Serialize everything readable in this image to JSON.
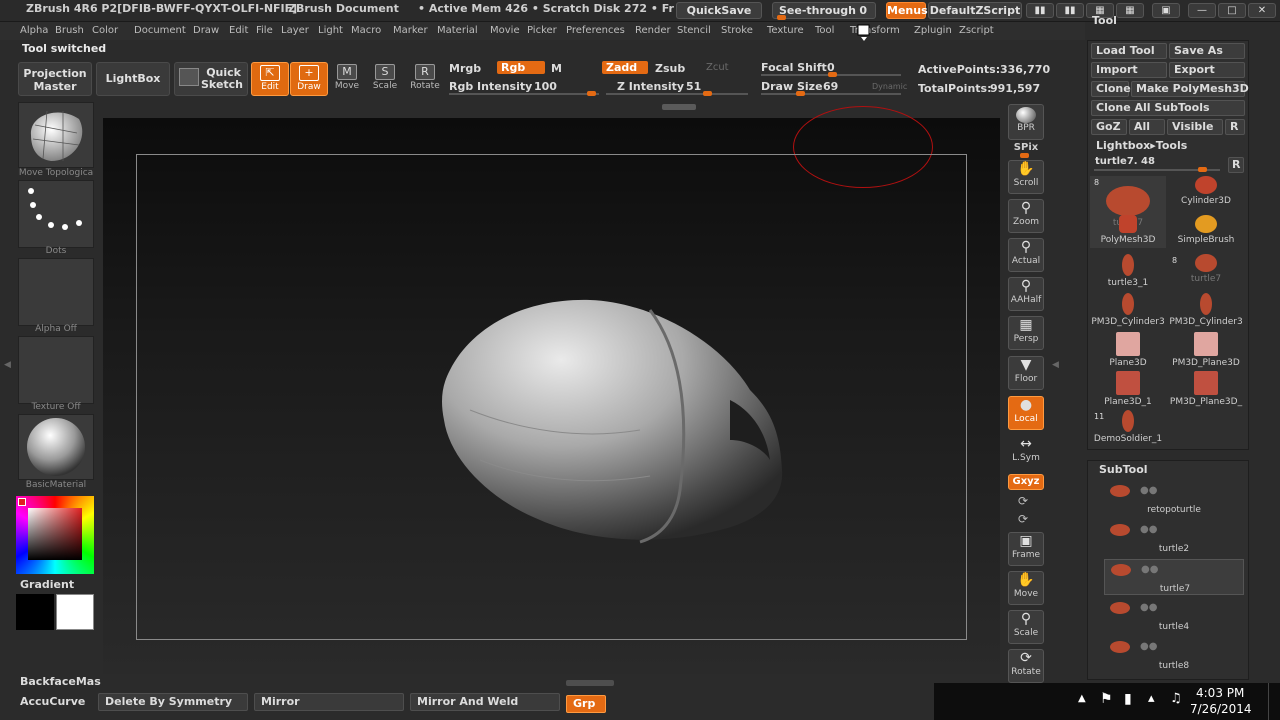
{
  "titlebar": {
    "app": "ZBrush 4R6  P2[DFIB-BWFF-QYXT-OLFI-NFIF]",
    "document": "ZBrush Document",
    "mem": "• Active Mem 426  • Scratch Disk 272  • Fr",
    "quicksave": "QuickSave",
    "seethrough": "See-through",
    "seethrough_value": "0",
    "menus": "Menus",
    "script": "DefaultZScript"
  },
  "menubar": [
    "Alpha",
    "Brush",
    "Color",
    "Document",
    "Draw",
    "Edit",
    "File",
    "Layer",
    "Light",
    "Macro",
    "Marker",
    "Material",
    "Movie",
    "Picker",
    "Preferences",
    "Render",
    "Stencil",
    "Stroke",
    "Texture",
    "Tool",
    "Transform",
    "Zplugin",
    "Zscript"
  ],
  "status": "Tool switched",
  "toolbar": {
    "projection_master": "Projection Master",
    "lightbox": "LightBox",
    "quick_sketch": "Quick Sketch",
    "edit": "Edit",
    "draw": "Draw",
    "move": "Move",
    "scale": "Scale",
    "rotate": "Rotate",
    "mrgb": "Mrgb",
    "rgb": "Rgb",
    "m": "M",
    "zadd": "Zadd",
    "zsub": "Zsub",
    "zcut": "Zcut",
    "rgb_intensity_label": "Rgb Intensity",
    "rgb_intensity": "100",
    "z_intensity_label": "Z Intensity",
    "z_intensity": "51",
    "focal_shift_label": "Focal Shift",
    "focal_shift": "0",
    "draw_size_label": "Draw Size",
    "draw_size": "69",
    "dynamic": "Dynamic",
    "active_points_label": "ActivePoints:",
    "active_points": "336,770",
    "total_points_label": "TotalPoints:",
    "total_points": "991,597"
  },
  "leftshelf": {
    "brush": "Move Topologica",
    "stroke": "Dots",
    "alpha": "Alpha  Off",
    "texture": "Texture  Off",
    "material": "BasicMaterial",
    "gradient": "Gradient",
    "backface": "BackfaceMas",
    "accucurve": "AccuCurve"
  },
  "rightshelf": [
    {
      "id": "bpr",
      "label": "BPR",
      "icon": "sphere-icon"
    },
    {
      "id": "spix",
      "label": "SPix"
    },
    {
      "id": "scroll",
      "label": "Scroll",
      "icon": "hand-icon"
    },
    {
      "id": "zoom",
      "label": "Zoom",
      "icon": "zoom-icon"
    },
    {
      "id": "actual",
      "label": "Actual",
      "icon": "zoom-icon"
    },
    {
      "id": "aahalf",
      "label": "AAHalf",
      "icon": "zoom-icon"
    },
    {
      "id": "persp",
      "label": "Persp",
      "icon": "grid-icon"
    },
    {
      "id": "floor",
      "label": "Floor",
      "icon": "floor-icon"
    },
    {
      "id": "local",
      "label": "Local",
      "icon": "local-icon"
    },
    {
      "id": "lsym",
      "label": "L.Sym",
      "icon": "sym-icon"
    },
    {
      "id": "xyz",
      "label": "Gxyz",
      "icon": "xyz-icon"
    },
    {
      "id": "frame",
      "label": "Frame",
      "icon": "frame-icon"
    },
    {
      "id": "move",
      "label": "Move",
      "icon": "hand-icon"
    },
    {
      "id": "scale",
      "label": "Scale",
      "icon": "zoom-icon"
    },
    {
      "id": "rotate",
      "label": "Rotate",
      "icon": "rotate-icon"
    }
  ],
  "toolpanel": {
    "title": "Tool",
    "load_tool": "Load Tool",
    "save_as": "Save As",
    "import": "Import",
    "export": "Export",
    "clone": "Clone",
    "make_polymesh": "Make PolyMesh3D",
    "clone_all": "Clone  All SubTools",
    "goz": "GoZ",
    "all": "All",
    "visible": "Visible",
    "r": "R",
    "lightbox_tools": "Lightbox▸Tools",
    "current_tool": "turtle7. 48",
    "items": [
      {
        "name": "turtle7",
        "badge": "8",
        "color": "#b84a2f",
        "shape": "blob"
      },
      {
        "name": "Cylinder3D",
        "color": "#c0432c",
        "shape": "cyl"
      },
      {
        "name": "PolyMesh3D",
        "color": "#c0432c",
        "shape": "star"
      },
      {
        "name": "SimpleBrush",
        "color": "#e39b21",
        "shape": "s"
      },
      {
        "name": "turtle3_1",
        "color": "#b84a2f",
        "shape": "thin"
      },
      {
        "name": "turtle7",
        "badge": "8",
        "color": "#b84a2f",
        "shape": "small"
      },
      {
        "name": "PM3D_Cylinder3",
        "color": "#b84a2f",
        "shape": "bent"
      },
      {
        "name": "PM3D_Cylinder3",
        "color": "#b84a2f",
        "shape": "bent"
      },
      {
        "name": "Plane3D",
        "color": "#e0a6a0",
        "shape": "plane"
      },
      {
        "name": "PM3D_Plane3D",
        "color": "#e0a6a0",
        "shape": "plane"
      },
      {
        "name": "Plane3D_1",
        "color": "#c05040",
        "shape": "plane"
      },
      {
        "name": "PM3D_Plane3D_",
        "color": "#c05040",
        "shape": "plane"
      },
      {
        "name": "DemoSoldier_1",
        "badge": "11",
        "color": "#b84a2f",
        "shape": "thin"
      }
    ]
  },
  "subtool": {
    "title": "SubTool",
    "items": [
      "retopoturtle",
      "turtle2",
      "turtle7",
      "turtle4",
      "turtle8"
    ]
  },
  "bottom": {
    "delete_by_symmetry": "Delete By Symmetry",
    "mirror": "Mirror",
    "mirror_and_weld": "Mirror And Weld",
    "grp": "Grp"
  },
  "taskbar": {
    "time": "4:03 PM",
    "date": "7/26/2014"
  },
  "colors": {
    "accent": "#e46a13",
    "panel": "#2f2f2f"
  }
}
